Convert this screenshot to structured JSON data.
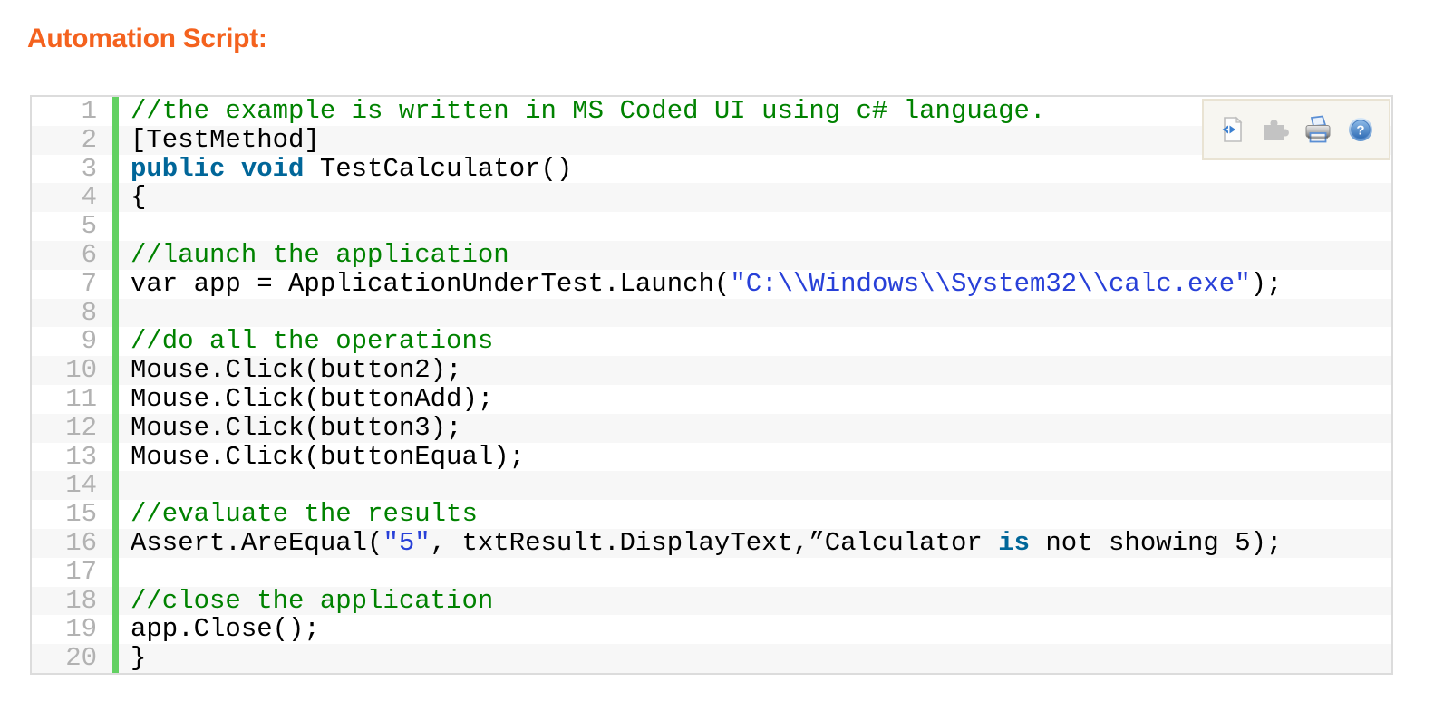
{
  "title": "Automation Script:",
  "colors": {
    "title": "#F4621E",
    "comment": "#008200",
    "keyword": "#006699",
    "string": "#2840D8",
    "line_number": "#B2B2B2",
    "gutter_bar": "#62D162",
    "alt_row": "#F7F7F7",
    "box_border": "#DCDCDC"
  },
  "toolbar": {
    "icons": [
      {
        "name": "view-source-icon",
        "title": "view source"
      },
      {
        "name": "copy-to-clipboard-icon",
        "title": "copy to clipboard"
      },
      {
        "name": "print-icon",
        "title": "print"
      },
      {
        "name": "help-icon",
        "title": "?"
      }
    ]
  },
  "code": {
    "language": "c#",
    "lines": [
      {
        "n": 1,
        "tokens": [
          [
            "c",
            "//the example is written in MS Coded UI using c# language."
          ]
        ]
      },
      {
        "n": 2,
        "tokens": [
          [
            "p",
            "[TestMethod]"
          ]
        ]
      },
      {
        "n": 3,
        "tokens": [
          [
            "k",
            "public"
          ],
          [
            "p",
            " "
          ],
          [
            "k",
            "void"
          ],
          [
            "p",
            " TestCalculator()"
          ]
        ]
      },
      {
        "n": 4,
        "tokens": [
          [
            "p",
            "{"
          ]
        ]
      },
      {
        "n": 5,
        "tokens": []
      },
      {
        "n": 6,
        "tokens": [
          [
            "c",
            "//launch the application"
          ]
        ]
      },
      {
        "n": 7,
        "tokens": [
          [
            "p",
            "var app = ApplicationUnderTest.Launch("
          ],
          [
            "s",
            "\"C:\\\\Windows\\\\System32\\\\calc.exe\""
          ],
          [
            "p",
            ");"
          ]
        ]
      },
      {
        "n": 8,
        "tokens": []
      },
      {
        "n": 9,
        "tokens": [
          [
            "c",
            "//do all the operations"
          ]
        ]
      },
      {
        "n": 10,
        "tokens": [
          [
            "p",
            "Mouse.Click(button2);"
          ]
        ]
      },
      {
        "n": 11,
        "tokens": [
          [
            "p",
            "Mouse.Click(buttonAdd);"
          ]
        ]
      },
      {
        "n": 12,
        "tokens": [
          [
            "p",
            "Mouse.Click(button3);"
          ]
        ]
      },
      {
        "n": 13,
        "tokens": [
          [
            "p",
            "Mouse.Click(buttonEqual);"
          ]
        ]
      },
      {
        "n": 14,
        "tokens": []
      },
      {
        "n": 15,
        "tokens": [
          [
            "c",
            "//evaluate the results"
          ]
        ]
      },
      {
        "n": 16,
        "tokens": [
          [
            "p",
            "Assert.AreEqual("
          ],
          [
            "s",
            "\"5\""
          ],
          [
            "p",
            ", txtResult.DisplayText,”Calculator "
          ],
          [
            "k",
            "is"
          ],
          [
            "p",
            " not showing 5);"
          ]
        ]
      },
      {
        "n": 17,
        "tokens": []
      },
      {
        "n": 18,
        "tokens": [
          [
            "c",
            "//close the application"
          ]
        ]
      },
      {
        "n": 19,
        "tokens": [
          [
            "p",
            "app.Close();"
          ]
        ]
      },
      {
        "n": 20,
        "tokens": [
          [
            "p",
            "}"
          ]
        ]
      }
    ]
  }
}
